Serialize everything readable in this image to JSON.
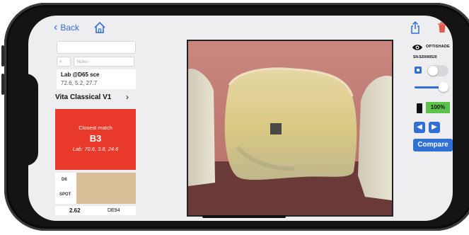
{
  "nav": {
    "back_label": "Back"
  },
  "form": {
    "small_field": "#",
    "notes_placeholder": "Notes"
  },
  "lab": {
    "title": "Lab @D65 sce",
    "values": "72.6, 5.2, 27.7"
  },
  "shade_guide": {
    "label": "Vita Classical V1"
  },
  "match": {
    "caption": "Closest match",
    "shade": "B3",
    "lab": "Lab: 70.6, 3.8, 24.6"
  },
  "comparison": {
    "label_top": "D6",
    "label_bottom": "SPOT",
    "delta_value": "2.62",
    "delta_label": "DE94"
  },
  "device": {
    "brand": "OPTISHADE",
    "serial": "SN-520000520",
    "battery": "100%",
    "battery_level": 1.0,
    "brightness_level": 0.75,
    "toggle_on": false
  },
  "actions": {
    "compare_label": "Compare"
  },
  "colors": {
    "accent": "#2f6fd6",
    "match_bg": "#e8392b",
    "swatch": "#d9bf98",
    "battery_green": "#5dc24a"
  }
}
